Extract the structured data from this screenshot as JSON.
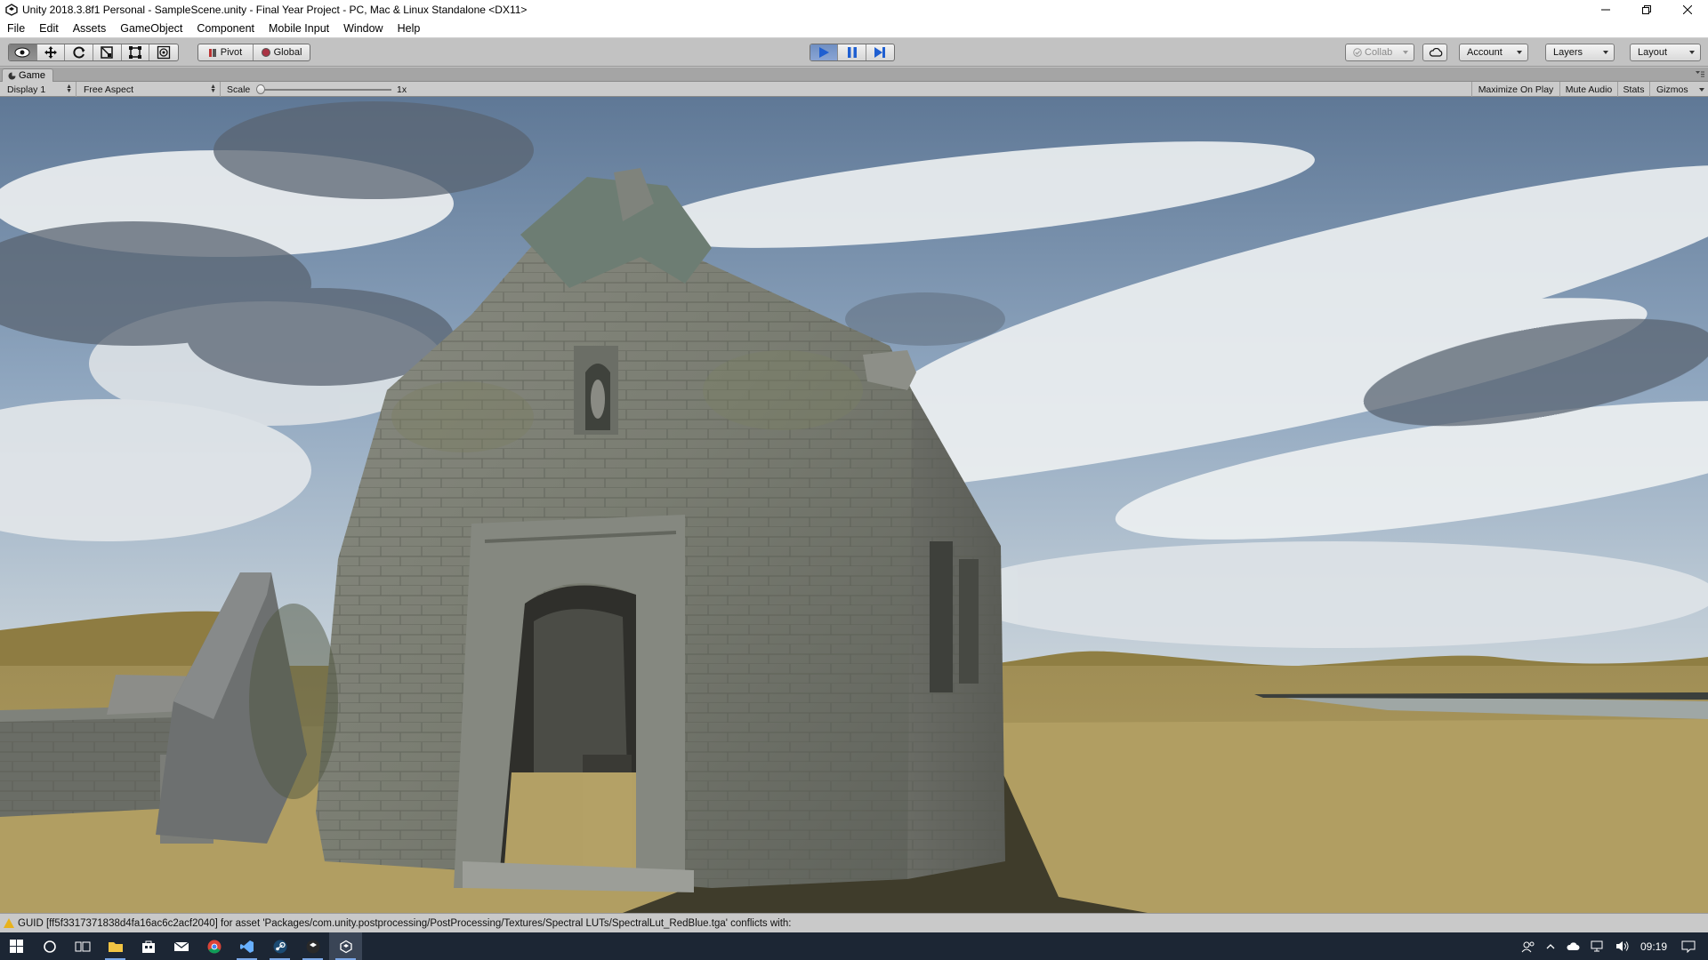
{
  "window": {
    "title": "Unity 2018.3.8f1 Personal - SampleScene.unity - Final Year Project - PC, Mac & Linux Standalone <DX11>"
  },
  "menu": [
    "File",
    "Edit",
    "Assets",
    "GameObject",
    "Component",
    "Mobile Input",
    "Window",
    "Help"
  ],
  "toolbar": {
    "transform_tools": [
      "hand-tool-icon",
      "move-tool-icon",
      "rotate-tool-icon",
      "scale-tool-icon",
      "rect-tool-icon",
      "transform-tool-icon"
    ],
    "pivot_label": "Pivot",
    "global_label": "Global",
    "play_state": "playing",
    "collab_label": "Collab",
    "account_label": "Account",
    "layers_label": "Layers",
    "layout_label": "Layout"
  },
  "game_view": {
    "tab_label": "Game",
    "display": "Display 1",
    "aspect": "Free Aspect",
    "scale_label": "Scale",
    "scale_value": "1x",
    "maximize_label": "Maximize On Play",
    "mute_label": "Mute Audio",
    "stats_label": "Stats",
    "gizmos_label": "Gizmos"
  },
  "console": {
    "message": "GUID [ff5f3317371838d4fa16ac6c2acf2040] for asset 'Packages/com.unity.postprocessing/PostProcessing/Textures/Spectral LUTs/SpectralLut_RedBlue.tga' conflicts with:"
  },
  "taskbar": {
    "time": "09:19"
  },
  "colors": {
    "play_active": "#6f8fc2",
    "editor_bg": "#c2c2c2",
    "taskbar_bg": "#1c2634",
    "warning": "#e8b21c"
  }
}
